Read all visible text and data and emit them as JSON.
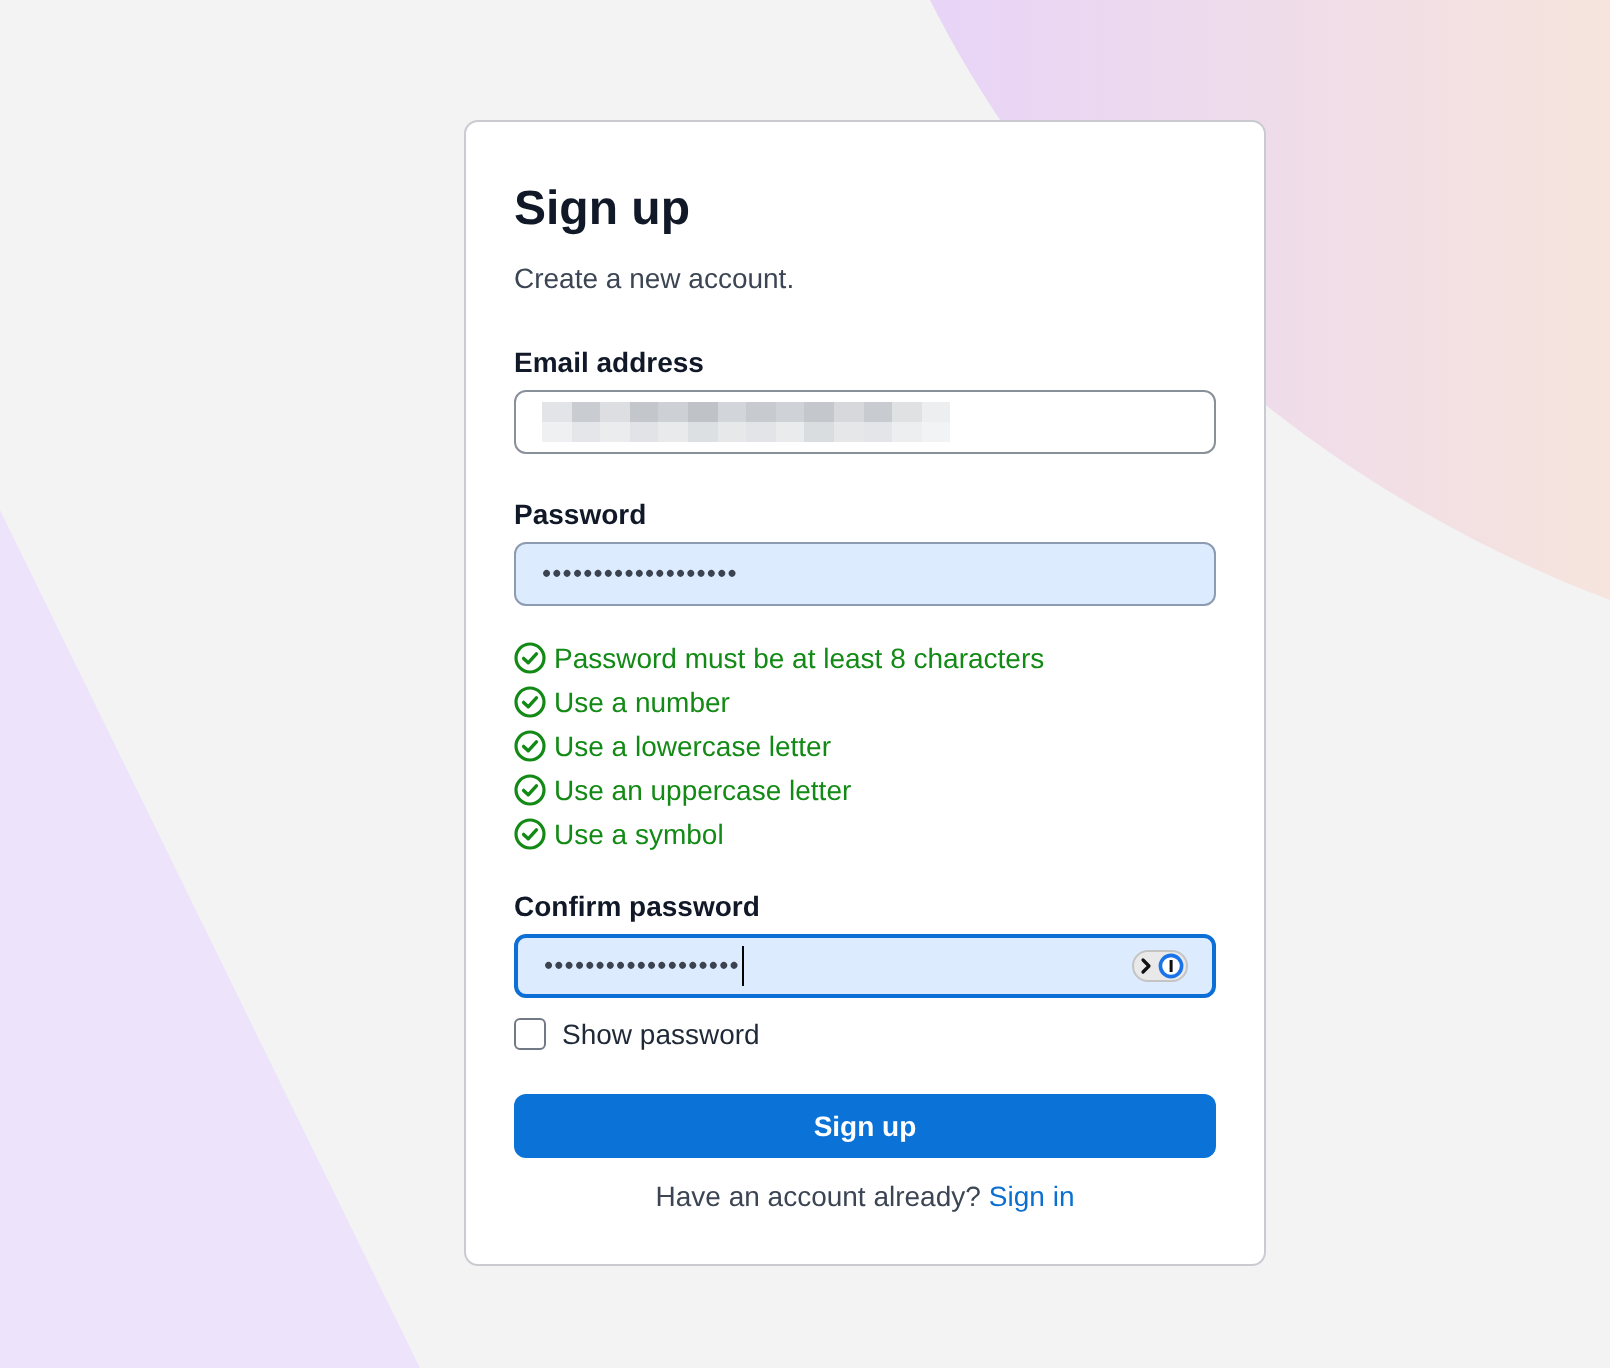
{
  "title": "Sign up",
  "subtitle": "Create a new account.",
  "fields": [
    {
      "label": "Email address",
      "redacted": true,
      "autofilled": false,
      "focused": false,
      "manager_badge": false
    },
    {
      "label": "Password",
      "redacted": false,
      "value": "•••••••••••••••••••",
      "autofilled": true,
      "focused": false,
      "manager_badge": false,
      "requirements": [
        {
          "text": "Password must be at least 8 characters",
          "met": true
        },
        {
          "text": "Use a number",
          "met": true
        },
        {
          "text": "Use a lowercase letter",
          "met": true
        },
        {
          "text": "Use an uppercase letter",
          "met": true
        },
        {
          "text": "Use a symbol",
          "met": true
        }
      ]
    },
    {
      "label": "Confirm password",
      "redacted": false,
      "value": "•••••••••••••••••••",
      "autofilled": true,
      "focused": true,
      "manager_badge": true
    }
  ],
  "show_password": {
    "label": "Show password",
    "checked": false
  },
  "submit_button": "Sign up",
  "footer": {
    "text": "Have an account already?",
    "link": "Sign in"
  }
}
